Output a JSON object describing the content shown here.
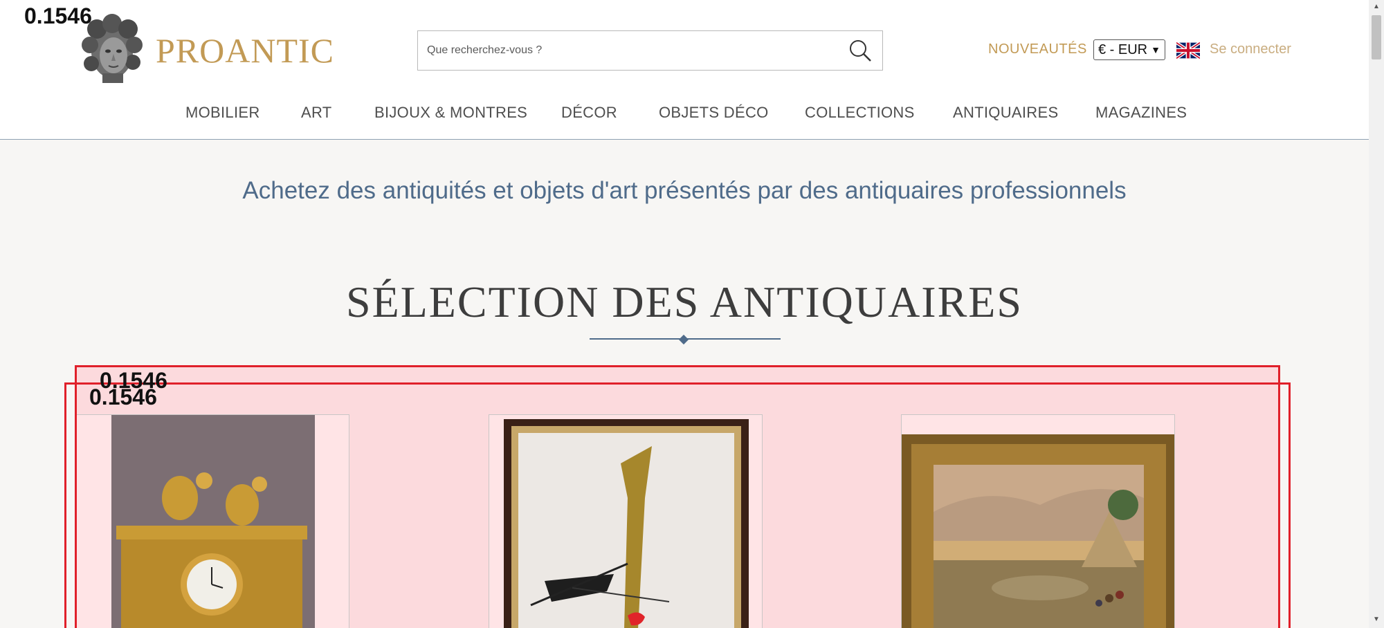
{
  "header": {
    "brand": "PROANTIC",
    "search": {
      "placeholder": "Que recherchez-vous ?",
      "value": ""
    },
    "nouveautes_label": "NOUVEAUTÉS",
    "currency": {
      "selected": "€ - EUR"
    },
    "language_flag": "uk-flag-icon",
    "login_label": "Se connecter"
  },
  "nav": {
    "items": [
      {
        "label": "MOBILIER"
      },
      {
        "label": "ART"
      },
      {
        "label": "BIJOUX & MONTRES"
      },
      {
        "label": "DÉCOR"
      },
      {
        "label": "OBJETS DÉCO"
      },
      {
        "label": "COLLECTIONS"
      },
      {
        "label": "ANTIQUAIRES"
      },
      {
        "label": "MAGAZINES"
      }
    ]
  },
  "main": {
    "tagline": "Achetez des antiquités et objets d'art présentés par des antiquaires professionnels",
    "section_title": "SÉLECTION DES ANTIQUAIRES",
    "products": [
      {
        "image": "gilt-bronze-mantel-clock-with-cherubs"
      },
      {
        "image": "framed-abstract-artwork"
      },
      {
        "image": "framed-landscape-painting"
      }
    ]
  },
  "overlay_scores": {
    "logo_score": "0.1546",
    "box_score_1": "0.1546",
    "box_score_2": "0.1546"
  },
  "colors": {
    "brand_gold": "#c29a55",
    "accent_blue": "#4f6b8a",
    "highlight_red": "#e0202a"
  }
}
